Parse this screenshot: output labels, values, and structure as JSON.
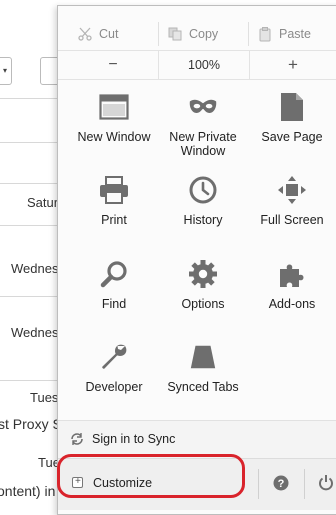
{
  "background": {
    "texts": [
      "Satur",
      "Wednes",
      "Wednes",
      "Tues",
      "st Proxy S",
      "Tue",
      "ontent) in"
    ]
  },
  "menu": {
    "edit": {
      "cut": "Cut",
      "copy": "Copy",
      "paste": "Paste"
    },
    "zoom": {
      "out": "−",
      "value": "100%",
      "in": "+"
    },
    "tiles": [
      {
        "label": "New Window",
        "icon": "new-window-icon"
      },
      {
        "label": "New Private Window",
        "icon": "private-mask-icon"
      },
      {
        "label": "Save Page",
        "icon": "save-page-icon"
      },
      {
        "label": "Print",
        "icon": "printer-icon"
      },
      {
        "label": "History",
        "icon": "clock-icon"
      },
      {
        "label": "Full Screen",
        "icon": "fullscreen-icon"
      },
      {
        "label": "Find",
        "icon": "magnifier-icon"
      },
      {
        "label": "Options",
        "icon": "gear-icon"
      },
      {
        "label": "Add-ons",
        "icon": "puzzle-icon"
      },
      {
        "label": "Developer",
        "icon": "wrench-icon"
      },
      {
        "label": "Synced Tabs",
        "icon": "synced-tabs-icon"
      }
    ],
    "sync": "Sign in to Sync",
    "customize": "Customize",
    "help_symbol": "?"
  },
  "colors": {
    "highlight": "#d9232b",
    "icon_gray": "#6e6e6e"
  }
}
